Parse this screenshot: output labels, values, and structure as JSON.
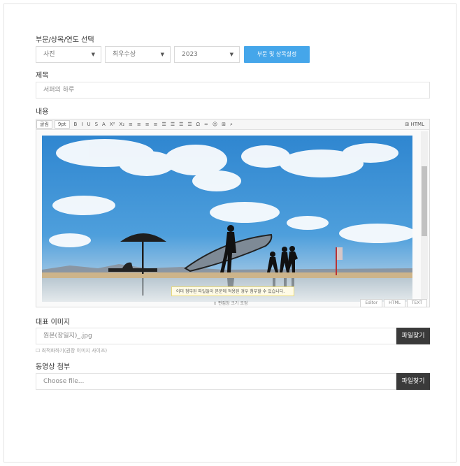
{
  "category_section": {
    "label": "부문/상목/연도 선택",
    "select_category": "사진",
    "select_award": "최우수상",
    "select_year": "2023",
    "apply_button": "부문 및 상목설정"
  },
  "title_section": {
    "label": "제목",
    "value": "서퍼의 하루"
  },
  "content_section": {
    "label": "내용",
    "toolbar": {
      "font_select": "굴림",
      "size_select": "9pt",
      "tools": [
        "B",
        "I",
        "U",
        "S",
        "A",
        "X²",
        "X₂",
        "≡",
        "≡",
        "≡",
        "≡",
        "☰",
        "☰",
        "☰",
        "☰",
        "Ω",
        "∞",
        "☺",
        "⊞",
        "⌕"
      ],
      "right_tool": "⊞ HTML"
    },
    "tooltip": "이미 첨부된 파일들이 본문에 적용된 경우 첨부할 수 있습니다.",
    "status": "↕ 편집창 크기 조정",
    "modes": [
      "Editor",
      "HTML",
      "TEXT"
    ]
  },
  "thumb_section": {
    "label": "대표 이미지",
    "file_value": "원본(장일지)_.jpg",
    "file_button": "파일찾기",
    "hint": "☐ 최적화하기(권장 이미지 사이즈)"
  },
  "video_section": {
    "label": "동영상 첨부",
    "file_placeholder": "Choose file...",
    "file_button": "파일찾기"
  },
  "colors": {
    "accent": "#45a6ea",
    "dark_button": "#3a3a3a",
    "sky": "#3b8ed6"
  }
}
